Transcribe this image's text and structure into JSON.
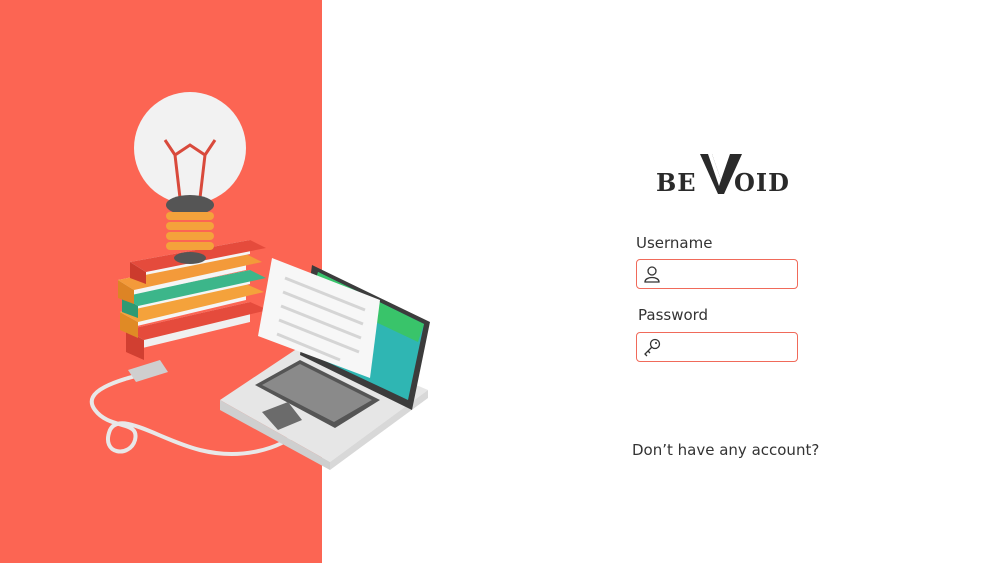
{
  "brand": {
    "logo_left": "BE",
    "logo_right": "OID",
    "accent_color": "#fc6553"
  },
  "form": {
    "username_label": "Username",
    "username_value": "",
    "username_icon": "user-icon",
    "password_label": "Password",
    "password_value": "",
    "password_icon": "key-icon"
  },
  "footer": {
    "signup_text": "Don’t have any account?"
  }
}
